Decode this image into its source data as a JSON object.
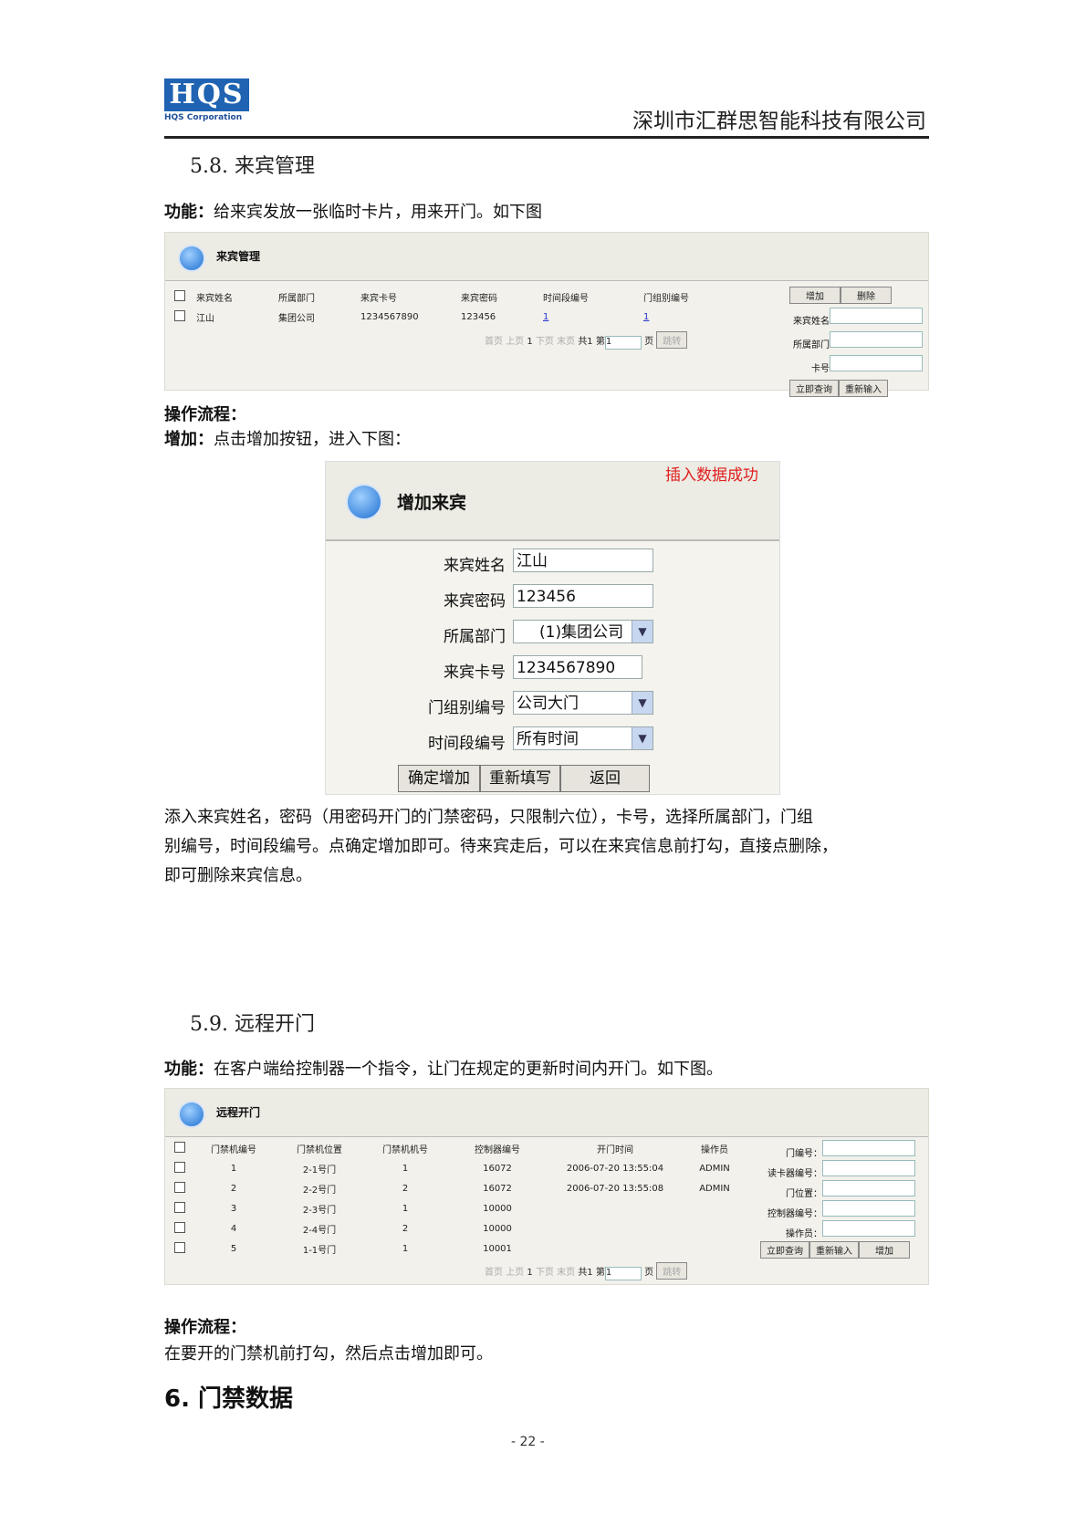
{
  "header": {
    "logo_text": "HQS",
    "logo_sub": "HQS Corporation",
    "company": "深圳市汇群思智能科技有限公司"
  },
  "sec_5_8": {
    "title": "5.8.  来宾管理",
    "func_label": "功能：",
    "func_text": "给来宾发放一张临时卡片，用来开门。如下图"
  },
  "guest_panel": {
    "title": "来宾管理",
    "columns": [
      "来宾姓名",
      "所属部门",
      "来宾卡号",
      "来宾密码",
      "时间段编号",
      "门组别编号"
    ],
    "rows": [
      [
        "江山",
        "集团公司",
        "1234567890",
        "123456",
        "1",
        "1"
      ]
    ],
    "pager": {
      "first": "首页",
      "prev": "上页",
      "page": "1",
      "next": "下页",
      "last": "末页",
      "total": "共1",
      "go_prefix": "第",
      "go_value": "1",
      "go_suffix": "页",
      "go_btn": "跳转"
    },
    "side_buttons": {
      "add": "增加",
      "delete": "删除",
      "query": "立即查询",
      "reset": "重新输入"
    },
    "side_fields": [
      "来宾姓名",
      "所属部门",
      "卡号"
    ]
  },
  "flow1": {
    "title": "操作流程：",
    "add_label": "增加：",
    "add_text": "点击增加按钮，进入下图："
  },
  "add_form": {
    "title": "增加来宾",
    "success_msg": "插入数据成功",
    "fields": [
      {
        "label": "来宾姓名",
        "value": "江山"
      },
      {
        "label": "来宾密码",
        "value": "123456"
      },
      {
        "label": "所属部门",
        "value": "(1)集团公司"
      },
      {
        "label": "来宾卡号",
        "value": "1234567890"
      },
      {
        "label": "门组别编号",
        "value": "公司大门"
      },
      {
        "label": "时间段编号",
        "value": "所有时间"
      }
    ],
    "buttons": {
      "confirm": "确定增加",
      "reset": "重新填写",
      "back": "返回"
    }
  },
  "desc": {
    "lines": [
      "添入来宾姓名，密码（用密码开门的门禁密码，只限制六位），卡号，选择所属部门，门组",
      "别编号，时间段编号。点确定增加即可。待来宾走后，可以在来宾信息前打勾，直接点删除，",
      "即可删除来宾信息。"
    ]
  },
  "sec_5_9": {
    "title": "5.9.  远程开门",
    "func_label": "功能：",
    "func_text": "在客户端给控制器一个指令，让门在规定的更新时间内开门。如下图。"
  },
  "remote_panel": {
    "title": "远程开门",
    "columns": [
      "门禁机编号",
      "门禁机位置",
      "门禁机机号",
      "控制器编号",
      "开门时间",
      "操作员"
    ],
    "rows": [
      [
        "1",
        "2-1号门",
        "1",
        "16072",
        "2006-07-20 13:55:04",
        "ADMIN"
      ],
      [
        "2",
        "2-2号门",
        "2",
        "16072",
        "2006-07-20 13:55:08",
        "ADMIN"
      ],
      [
        "3",
        "2-3号门",
        "1",
        "10000",
        "",
        ""
      ],
      [
        "4",
        "2-4号门",
        "2",
        "10000",
        "",
        ""
      ],
      [
        "5",
        "1-1号门",
        "1",
        "10001",
        "",
        ""
      ]
    ],
    "side_fields": [
      "门编号：",
      "读卡器编号：",
      "门位置：",
      "控制器编号：",
      "操作员："
    ],
    "side_buttons": {
      "query": "立即查询",
      "reset": "重新输入",
      "add": "增加"
    },
    "pager": {
      "first": "首页",
      "prev": "上页",
      "page": "1",
      "next": "下页",
      "last": "末页",
      "total": "共1",
      "go_prefix": "第",
      "go_value": "1",
      "go_suffix": "页",
      "go_btn": "跳转"
    }
  },
  "flow2": {
    "title": "操作流程：",
    "text": "在要开的门禁机前打勾，然后点击增加即可。"
  },
  "sec_6": {
    "title": "6.  门禁数据"
  },
  "footer": {
    "page_num": "- 22 -"
  }
}
